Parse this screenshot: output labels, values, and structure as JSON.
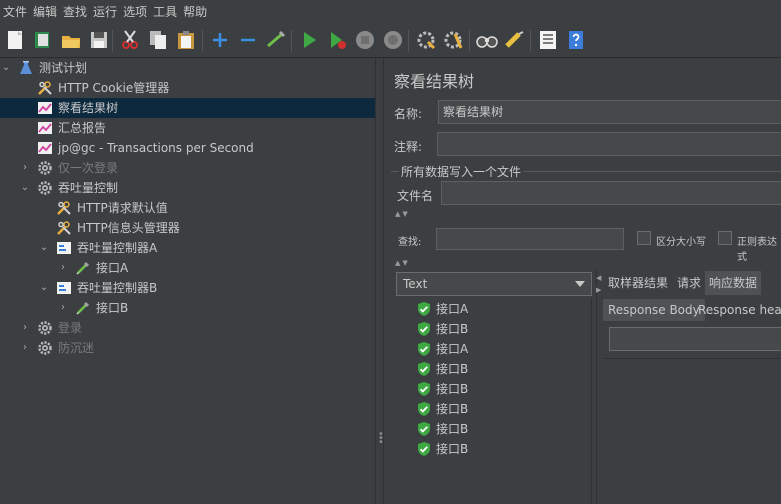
{
  "menu": [
    "文件",
    "编辑",
    "查找",
    "运行",
    "选项",
    "工具",
    "帮助"
  ],
  "toolbar_icons": [
    "new-icon",
    "templates-icon",
    "open-icon",
    "save-icon",
    "cut-icon",
    "copy-icon",
    "paste-icon",
    "expand-icon",
    "collapse-icon",
    "toggle-icon",
    "start-icon",
    "start-no-pause-icon",
    "stop-icon",
    "shutdown-icon",
    "clear-icon",
    "clear-all-icon",
    "search-icon",
    "reset-search-icon",
    "function-helper-icon",
    "help-icon"
  ],
  "tree": [
    {
      "label": "测试计划",
      "icon": "flask-icon",
      "expanded": true
    },
    {
      "label": "HTTP Cookie管理器",
      "icon": "wrench-icon"
    },
    {
      "label": "察看结果树",
      "icon": "chart-icon",
      "selected": true
    },
    {
      "label": "汇总报告",
      "icon": "chart-icon"
    },
    {
      "label": "jp@gc - Transactions per Second",
      "icon": "chart-icon"
    },
    {
      "label": "仅一次登录",
      "icon": "gear-icon",
      "disabled": true
    },
    {
      "label": "吞吐量控制",
      "icon": "gear-icon",
      "expanded": true
    },
    {
      "label": "HTTP请求默认值",
      "icon": "wrench-icon"
    },
    {
      "label": "HTTP信息头管理器",
      "icon": "wrench-icon"
    },
    {
      "label": "吞吐量控制器A",
      "icon": "controller-icon",
      "expanded": true
    },
    {
      "label": "接口A",
      "icon": "pipette-icon"
    },
    {
      "label": "吞吐量控制器B",
      "icon": "controller-icon",
      "expanded": true
    },
    {
      "label": "接口B",
      "icon": "pipette-icon"
    },
    {
      "label": "登录",
      "icon": "gear-icon",
      "disabled": true
    },
    {
      "label": "防沉迷",
      "icon": "gear-icon",
      "disabled": true
    }
  ],
  "panel": {
    "title": "察看结果树",
    "name_label": "名称:",
    "name_value": "察看结果树",
    "comment_label": "注释:",
    "comment_value": "",
    "file_group_label": "所有数据写入一个文件",
    "filename_label": "文件名",
    "filename_value": "",
    "search_label": "查找:",
    "search_value": "",
    "case_sensitive_label": "区分大小写",
    "regex_label": "正则表达式"
  },
  "renderer": {
    "selected": "Text"
  },
  "results": [
    "接口A",
    "接口B",
    "接口A",
    "接口B",
    "接口B",
    "接口B",
    "接口B",
    "接口B"
  ],
  "detail_tabs": [
    "取样器结果",
    "请求",
    "响应数据"
  ],
  "detail_active_tab": "响应数据",
  "response_tabs": [
    "Response Body",
    "Response headers"
  ],
  "response_active_tab": "Response Body",
  "colors": {
    "selection": "#0d293e",
    "background": "#3c3f41",
    "success": "#4caf50"
  }
}
